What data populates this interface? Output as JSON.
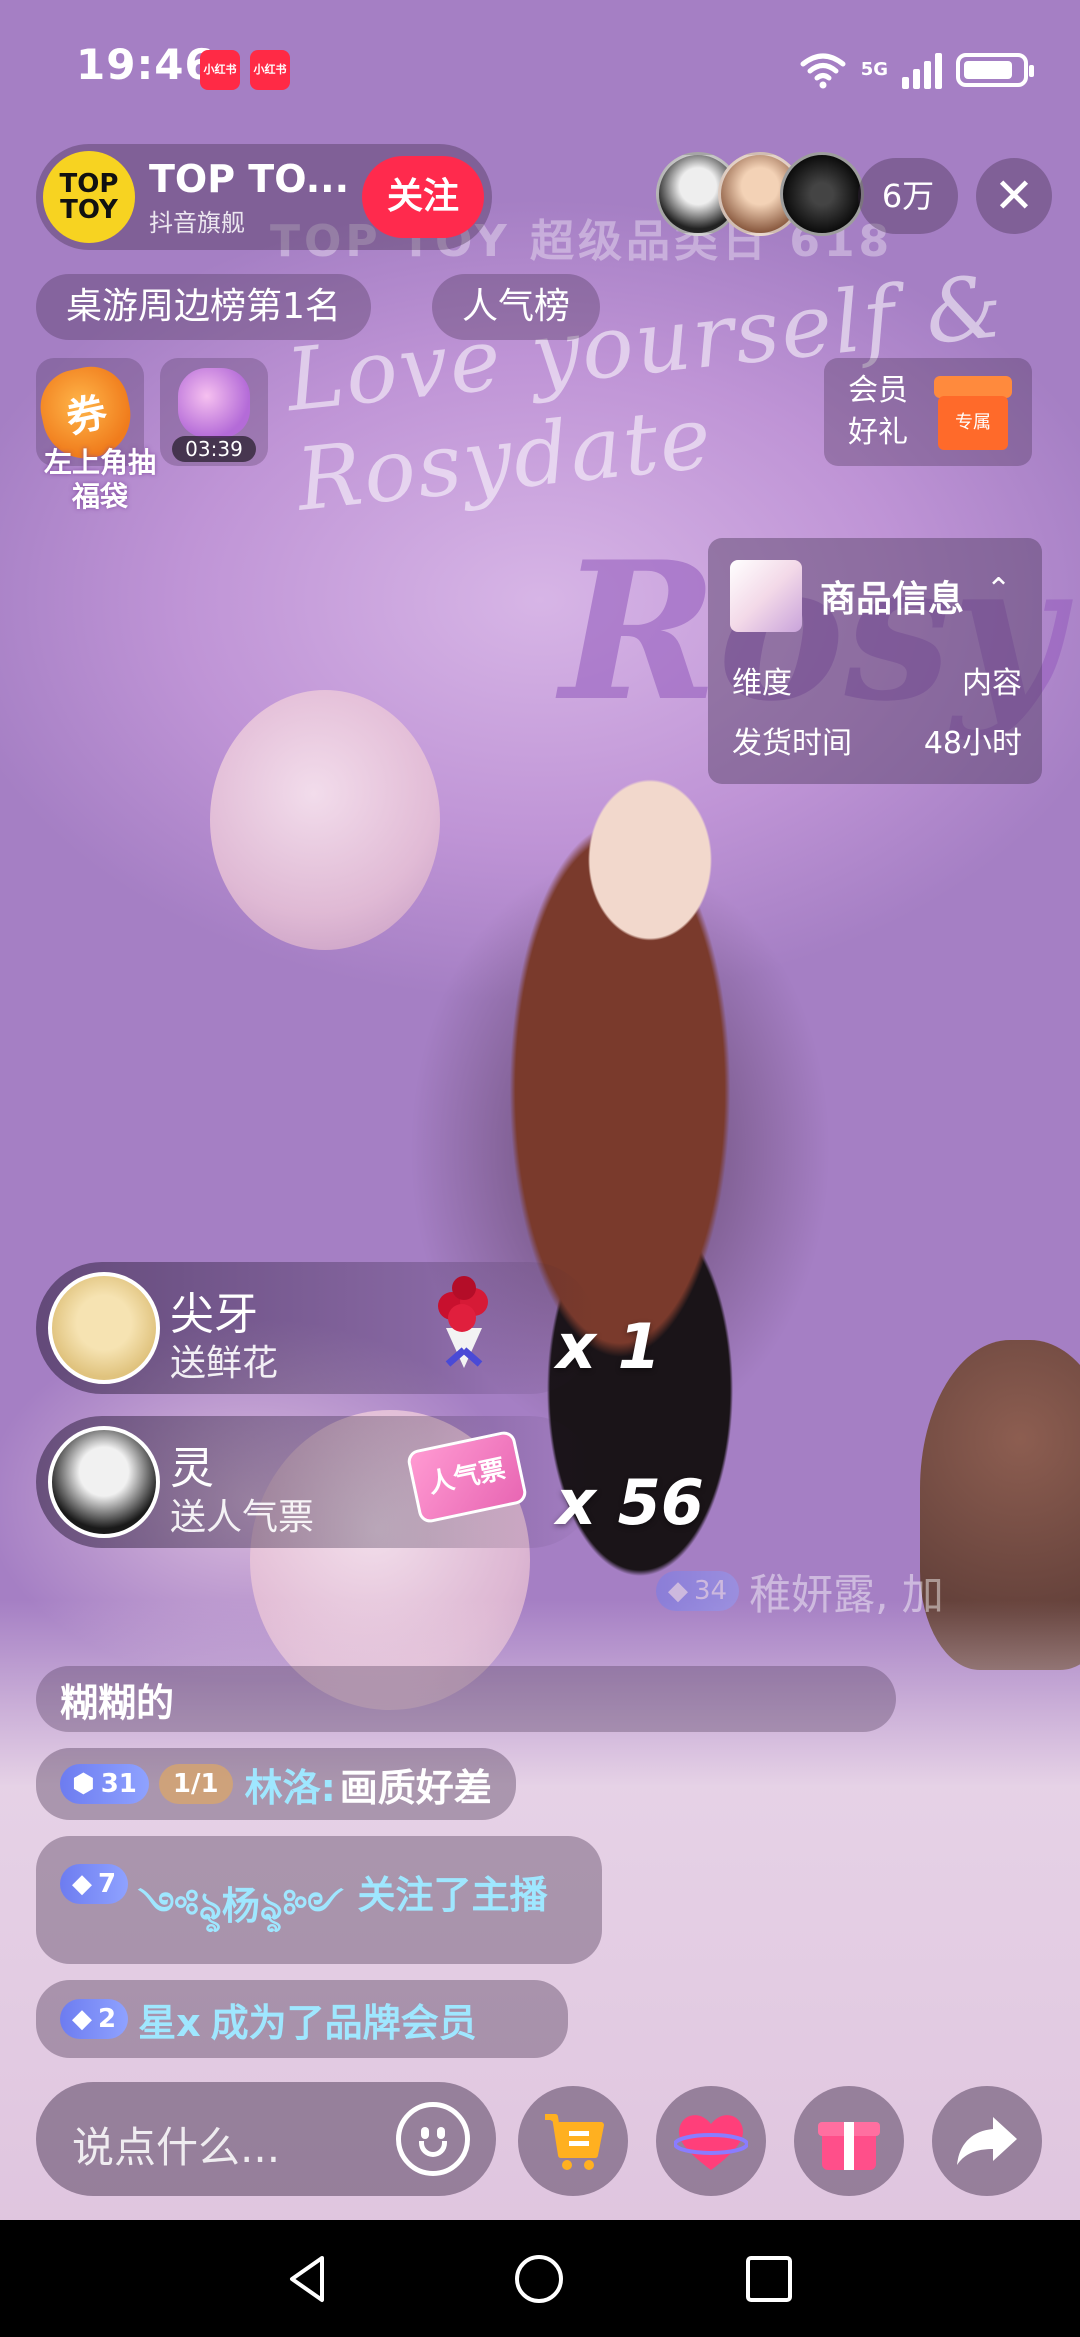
{
  "status_bar": {
    "time": "19:46",
    "notifications": [
      "小红书",
      "小红书"
    ],
    "network": "5G",
    "icons": [
      "wifi-icon",
      "signal-icon",
      "battery-icon"
    ]
  },
  "host": {
    "logo_top": "TOP",
    "logo_bottom": "TOY",
    "name": "TOP TO...",
    "subtitle": "抖音旗舰",
    "follow_label": "关注"
  },
  "audience": {
    "count": "6万",
    "close_label": "✕"
  },
  "rank_chips": {
    "board": "桌游周边榜第1名",
    "popularity": "人气榜"
  },
  "activities": {
    "coupon_badge": "券",
    "lucky_bag_label": "左上角抽福袋",
    "gift_timer": "03:39",
    "member_line1": "会员",
    "member_line2": "好礼",
    "member_tag": "专属"
  },
  "product_card": {
    "title": "商品信息",
    "chevron": "⌃",
    "rows": [
      {
        "key": "维度",
        "value": "内容"
      },
      {
        "key": "发货时间",
        "value": "48小时"
      }
    ]
  },
  "background": {
    "store_sign": "TOP TOY  超级品类日 618",
    "banner": "Love yourself & Rosydate",
    "big_word": "Rosy"
  },
  "gift_toasts": [
    {
      "user": "尖牙",
      "action": "送鲜花",
      "count": "x 1",
      "item_icon": "rose-bouquet-icon"
    },
    {
      "user": "灵",
      "action": "送人气票",
      "count": "x 56",
      "item_icon": "popularity-ticket-icon",
      "item_text": "人气票"
    }
  ],
  "chat": {
    "faded": {
      "badge": "34",
      "text": "稚妍露, 加"
    },
    "system_name": "糊糊的",
    "messages": [
      {
        "level": "31",
        "fan_badge": "1/1",
        "user": "林洛:",
        "text": "画质好差"
      },
      {
        "level": "7",
        "user": "༺ৡ杨ৡ༻",
        "text": "关注了主播"
      },
      {
        "level": "2",
        "user": "星x",
        "text": "成为了品牌会员"
      }
    ]
  },
  "bottom_bar": {
    "input_placeholder": "说点什么...",
    "buttons": [
      "emoji-icon",
      "shopping-cart-icon",
      "like-heart-icon",
      "gift-icon",
      "share-icon"
    ]
  },
  "colors": {
    "accent": "#ff2a4d",
    "chat_name": "#9fe7ff",
    "logo_yellow": "#f7d321"
  }
}
